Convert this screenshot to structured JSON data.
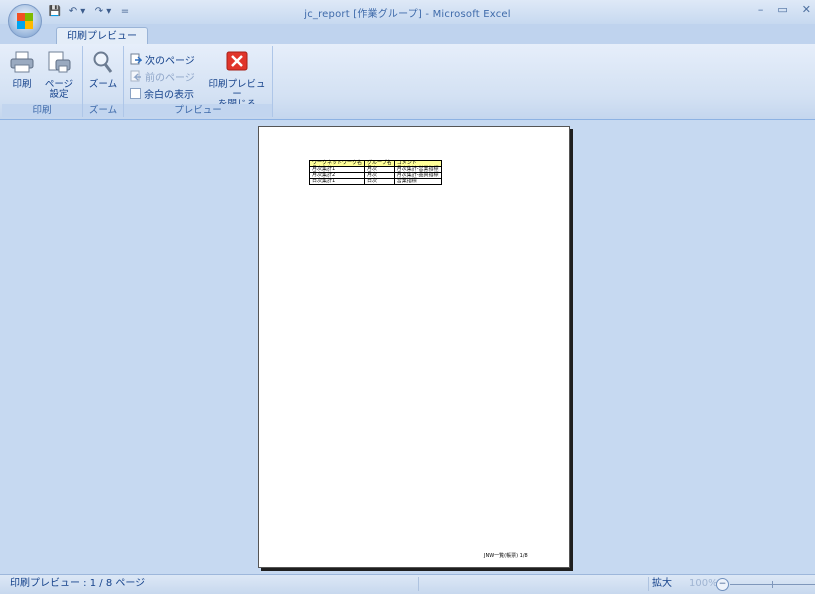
{
  "window": {
    "title": "jc_report [作業グループ] - Microsoft Excel",
    "qat": [
      "💾",
      "↶ ▾",
      "↷ ▾",
      "="
    ],
    "controls": [
      "–",
      "▭",
      "✕"
    ]
  },
  "tab": {
    "label": "印刷プレビュー"
  },
  "ribbon": {
    "groups": {
      "print": {
        "label": "印刷",
        "print_button": "印刷",
        "page_setup_button": "ページ\n設定"
      },
      "zoom": {
        "label": "ズーム",
        "zoom_button": "ズーム"
      },
      "preview": {
        "label": "プレビュー",
        "next_page": "次のページ",
        "prev_page": "前のページ",
        "show_margins": "余白の表示",
        "close_preview": "印刷プレビュー\nを閉じる"
      }
    }
  },
  "sheet": {
    "headers": [
      "ワークネットワーク名",
      "グループ名",
      "コメント"
    ],
    "rows": [
      [
        "月次集計1",
        "月次",
        "月次集計-営業指標"
      ],
      [
        "月次集計2",
        "月次",
        "月次集計-品質指標"
      ],
      [
        "日次集計1",
        "日次",
        "営業指標"
      ]
    ],
    "footer": "JNW一覧(帳票) 1/8"
  },
  "status": {
    "text": "印刷プレビュー : 1 / 8 ページ",
    "zoom_label": "拡大",
    "zoom_value": "100%",
    "zoom_minus": "−"
  },
  "colors": {
    "workspace": "#c6d9f1",
    "header_fill": "#ffff99",
    "close_icon": "#e0352b"
  }
}
